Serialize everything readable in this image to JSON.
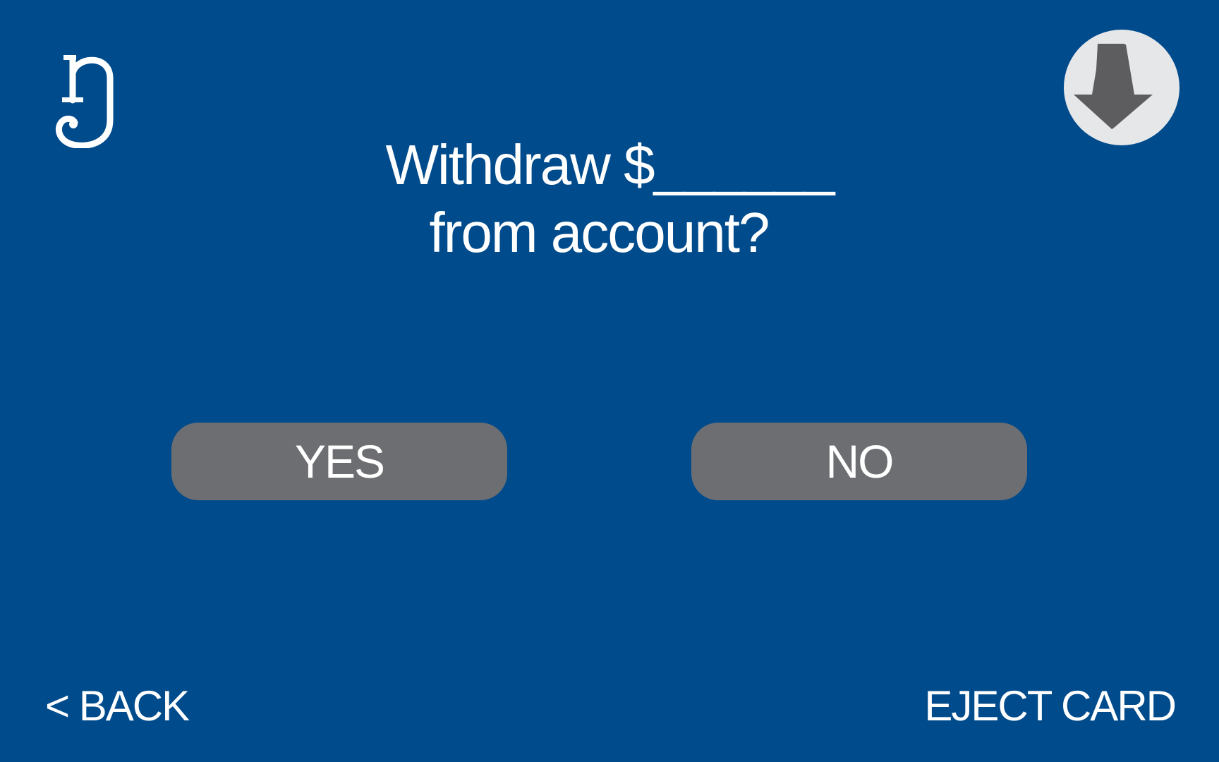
{
  "brand": {
    "logo_icon": "eng-glyph-logo"
  },
  "header": {
    "download_icon": "down-arrow-icon",
    "colors": {
      "background": "#004b8c",
      "download_circle": "#e6e7e9",
      "download_arrow": "#5d5d5f"
    }
  },
  "prompt": {
    "line1": "Withdraw $______",
    "line2": "from account?"
  },
  "choices": {
    "yes_label": "YES",
    "no_label": "NO",
    "button_color": "#6d6e71"
  },
  "footer": {
    "back_label": "< BACK",
    "eject_label": "EJECT CARD"
  }
}
